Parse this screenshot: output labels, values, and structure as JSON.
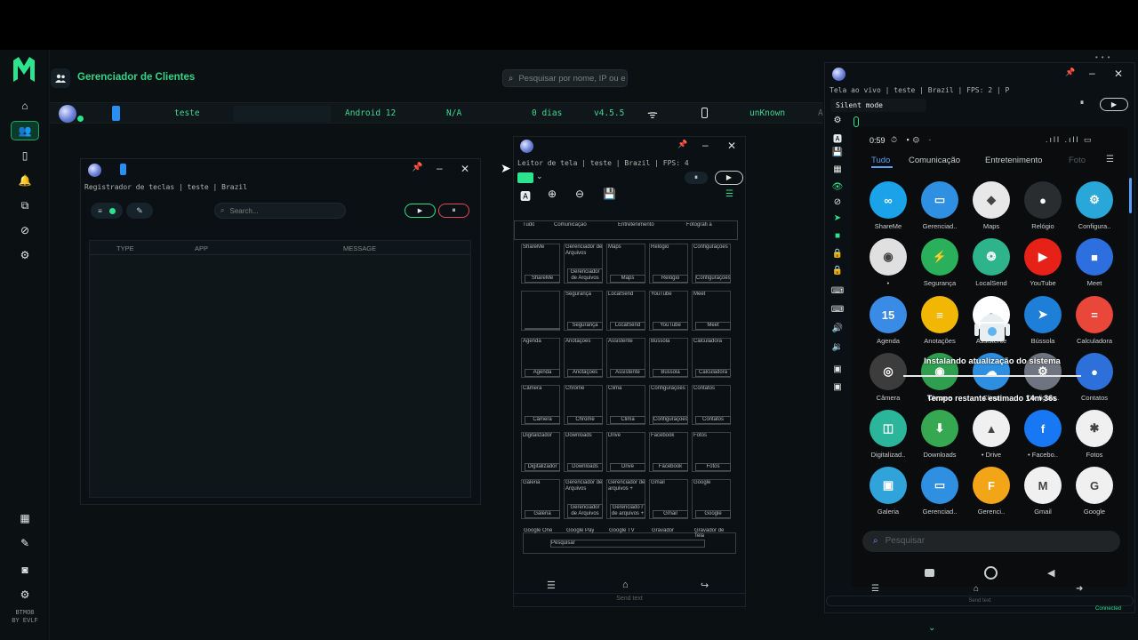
{
  "brand": {
    "line1": "BTMOB",
    "line2": "BY EVLF"
  },
  "header": {
    "title": "Gerenciador de Clientes",
    "search_placeholder": "Pesquisar por nome, IP ou e"
  },
  "client_row": {
    "name": "teste",
    "android": "Android 12",
    "ip": "N/A",
    "days": "0 dias",
    "version": "v4.5.5",
    "status": "unKnown",
    "extra": "A"
  },
  "keylogger": {
    "title": "Registrador de teclas | teste | Brazil",
    "search_placeholder": "Search...",
    "columns": [
      "TYPE",
      "APP",
      "MESSAGE"
    ]
  },
  "screen_reader": {
    "title": "Leitor de tela | teste | Brazil | FPS: 4",
    "send_placeholder": "Send text",
    "tabs": [
      "Tudo",
      "Comunicação",
      "Entretenimento",
      "Fotografi a"
    ],
    "grid": [
      [
        "ShareMe",
        "Gerenciador de Arquivos",
        "Maps",
        "Relógio",
        "Configurações"
      ],
      [
        "",
        "Segurança",
        "LocalSend",
        "YouTube",
        "Meet"
      ],
      [
        "Agenda",
        "Anotações",
        "Assistente",
        "Bússola",
        "Calculadora"
      ],
      [
        "Câmera",
        "Chrome",
        "Clima",
        "Configurações",
        "Contatos"
      ],
      [
        "Digitalizador",
        "Downloads",
        "Drive",
        "Facebook",
        "Fotos"
      ],
      [
        "Galeria",
        "Gerenciador de Arquivos",
        "Gerenciador de arquivos +",
        "Gmail",
        "Google"
      ]
    ],
    "grid_bottom_labels": [
      [
        "ShareMe",
        "Gerenciador de Arquivos",
        "Maps",
        "Relógio",
        "Configurações"
      ],
      [
        "",
        "Segurança",
        "LocalSend",
        "YouTube",
        "Meet"
      ],
      [
        "Agenda",
        "Anotações",
        "Assistente",
        "Bússola",
        "Calculadora"
      ],
      [
        "Câmera",
        "Chrome",
        "Clima",
        "Configurações",
        "Contatos"
      ],
      [
        "Digitalizador",
        "Downloads",
        "Drive",
        "Facebook",
        "Fotos"
      ],
      [
        "Galeria",
        "Gerenciador de Arquivos",
        "Gerenciado r de arquivos +",
        "Gmail",
        "Google"
      ]
    ],
    "last_row": [
      "Google One",
      "Google Pay",
      "Google TV",
      "Gravador",
      "Gravador de Tela"
    ],
    "search_label": "Pesquisar"
  },
  "live_screen": {
    "title": "Tela ao vivo | teste | Brazil | FPS: 2 | P",
    "mode": "Silent mode",
    "send_placeholder": "Send text",
    "connected": "Connected",
    "phone": {
      "time": "0:59",
      "tabs": [
        "Tudo",
        "Comunicação",
        "Entretenimento",
        "Foto"
      ],
      "apps": [
        {
          "label": "ShareMe",
          "color": "#1aa3e8",
          "glyph": "∞"
        },
        {
          "label": "Gerenciad..",
          "color": "#2f8fe0",
          "glyph": "▭"
        },
        {
          "label": "Maps",
          "color": "#e8e8e8",
          "glyph": "◆"
        },
        {
          "label": "Relógio",
          "color": "#2a2d30",
          "glyph": "●"
        },
        {
          "label": "Configura..",
          "color": "#2aa7d9",
          "glyph": "⚙"
        },
        {
          "label": "•",
          "color": "#e0e0e0",
          "glyph": "◉"
        },
        {
          "label": "Segurança",
          "color": "#2aaf5a",
          "glyph": "⚡"
        },
        {
          "label": "LocalSend",
          "color": "#2db48a",
          "glyph": "❂"
        },
        {
          "label": "YouTube",
          "color": "#e62117",
          "glyph": "▶"
        },
        {
          "label": "Meet",
          "color": "#2e6fe0",
          "glyph": "■"
        },
        {
          "label": "Agenda",
          "color": "#3a8be5",
          "glyph": "15"
        },
        {
          "label": "Anotações",
          "color": "#f2b705",
          "glyph": "≡"
        },
        {
          "label": "Assistente",
          "color": "#ffffff",
          "glyph": "●"
        },
        {
          "label": "Bússola",
          "color": "#1e7fd8",
          "glyph": "➤"
        },
        {
          "label": "Calculadora",
          "color": "#e8473a",
          "glyph": "="
        },
        {
          "label": "Câmera",
          "color": "#3c3c3c",
          "glyph": "◎"
        },
        {
          "label": "Chrome",
          "color": "#2f9f4f",
          "glyph": "◉"
        },
        {
          "label": "Clima",
          "color": "#2e8fe0",
          "glyph": "☁"
        },
        {
          "label": "Configura..",
          "color": "#6f7580",
          "glyph": "⚙"
        },
        {
          "label": "Contatos",
          "color": "#2e70d9",
          "glyph": "●"
        },
        {
          "label": "Digitalizad..",
          "color": "#2bb59a",
          "glyph": "◫"
        },
        {
          "label": "Downloads",
          "color": "#36a852",
          "glyph": "⬇"
        },
        {
          "label": "• Drive",
          "color": "#f0f0f0",
          "glyph": "▲"
        },
        {
          "label": "• Facebo..",
          "color": "#1877f2",
          "glyph": "f"
        },
        {
          "label": "Fotos",
          "color": "#f0f0f0",
          "glyph": "✱"
        },
        {
          "label": "Galeria",
          "color": "#30a3da",
          "glyph": "▣"
        },
        {
          "label": "Gerenciad..",
          "color": "#2f8fe0",
          "glyph": "▭"
        },
        {
          "label": "Gerenci..",
          "color": "#f2a516",
          "glyph": "F"
        },
        {
          "label": "Gmail",
          "color": "#f0f0f0",
          "glyph": "M"
        },
        {
          "label": "Google",
          "color": "#f0f0f0",
          "glyph": "G"
        }
      ],
      "overlay_title": "Instalando atualização do sistema",
      "overlay_time": "Tempo restante estimado  14m 36s",
      "search_placeholder": "Pesquisar"
    }
  },
  "colors": {
    "accent": "#2de38d",
    "bg": "#0b1013"
  }
}
